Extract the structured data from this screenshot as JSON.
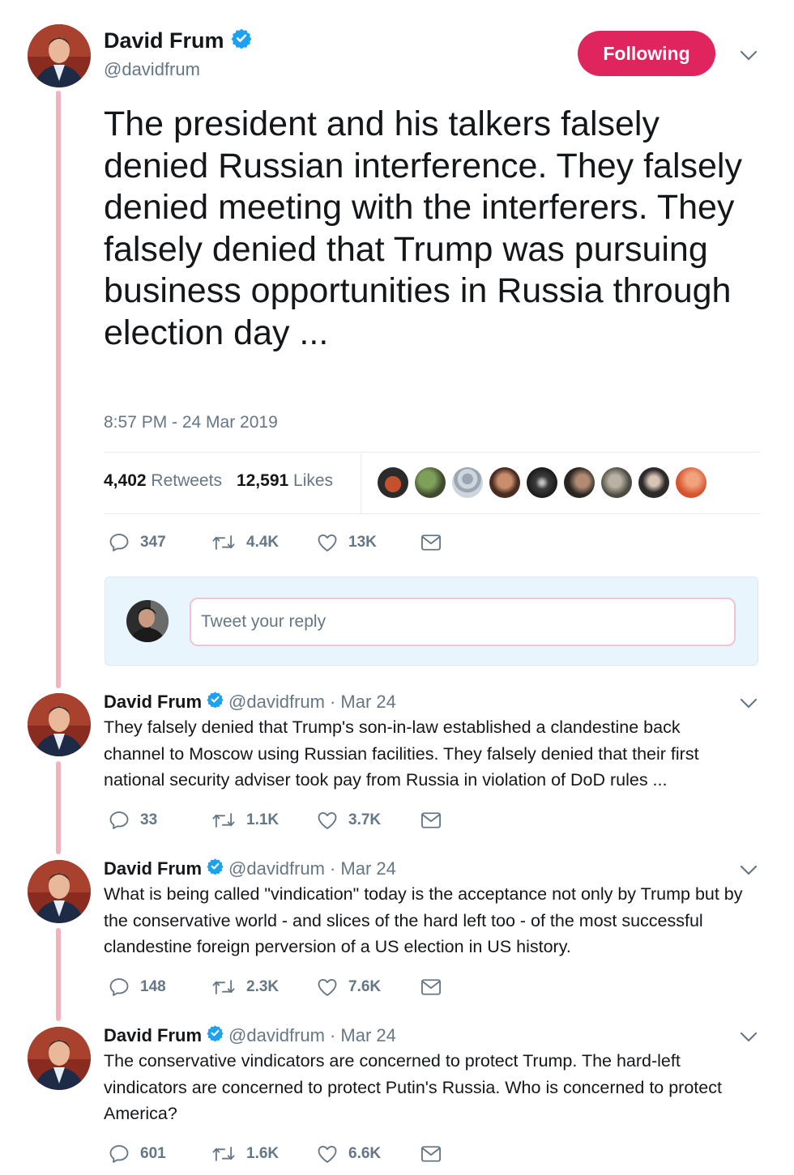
{
  "main_tweet": {
    "author_name": "David Frum",
    "handle": "@davidfrum",
    "follow_label": "Following",
    "text": "The president and his talkers falsely denied Russian interference. They falsely denied meeting with the interferers. They falsely denied that Trump was pursuing business opportunities in Russia through election day ...",
    "timestamp": "8:57 PM - 24 Mar 2019",
    "retweets_count": "4,402",
    "retweets_label": "Retweets",
    "likes_count": "12,591",
    "likes_label": "Likes",
    "reply_count": "347",
    "retweet_count_short": "4.4K",
    "like_count_short": "13K"
  },
  "reply_box": {
    "placeholder": "Tweet your reply"
  },
  "thread": [
    {
      "author_name": "David Frum",
      "handle": "@davidfrum",
      "date": "· Mar 24",
      "text": "They falsely denied that Trump's son-in-law established a clandestine back channel to Moscow using Russian facilities. They falsely denied that their first national security adviser took pay from Russia in violation of DoD rules ...",
      "replies": "33",
      "retweets": "1.1K",
      "likes": "3.7K"
    },
    {
      "author_name": "David Frum",
      "handle": "@davidfrum",
      "date": "· Mar 24",
      "text": "What is being called \"vindication\" today is the acceptance not only by Trump but by the conservative world - and slices of the hard left too - of the most successful clandestine foreign perversion of a US election in US history.",
      "replies": "148",
      "retweets": "2.3K",
      "likes": "7.6K"
    },
    {
      "author_name": "David Frum",
      "handle": "@davidfrum",
      "date": "· Mar 24",
      "text": "The conservative vindicators are concerned to protect Trump. The hard-left vindicators are concerned to protect Putin's Russia. Who is concerned to protect America?",
      "replies": "601",
      "retweets": "1.6K",
      "likes": "6.6K"
    }
  ],
  "icons": {
    "reply": "reply-icon",
    "retweet": "retweet-icon",
    "like": "heart-icon",
    "dm": "envelope-icon",
    "verified": "verified-badge-icon",
    "caret": "chevron-down-icon"
  },
  "colors": {
    "accent": "#e0245e",
    "verified": "#1da1f2",
    "thread_line": "#f3b2bf",
    "muted_text": "#657786"
  }
}
